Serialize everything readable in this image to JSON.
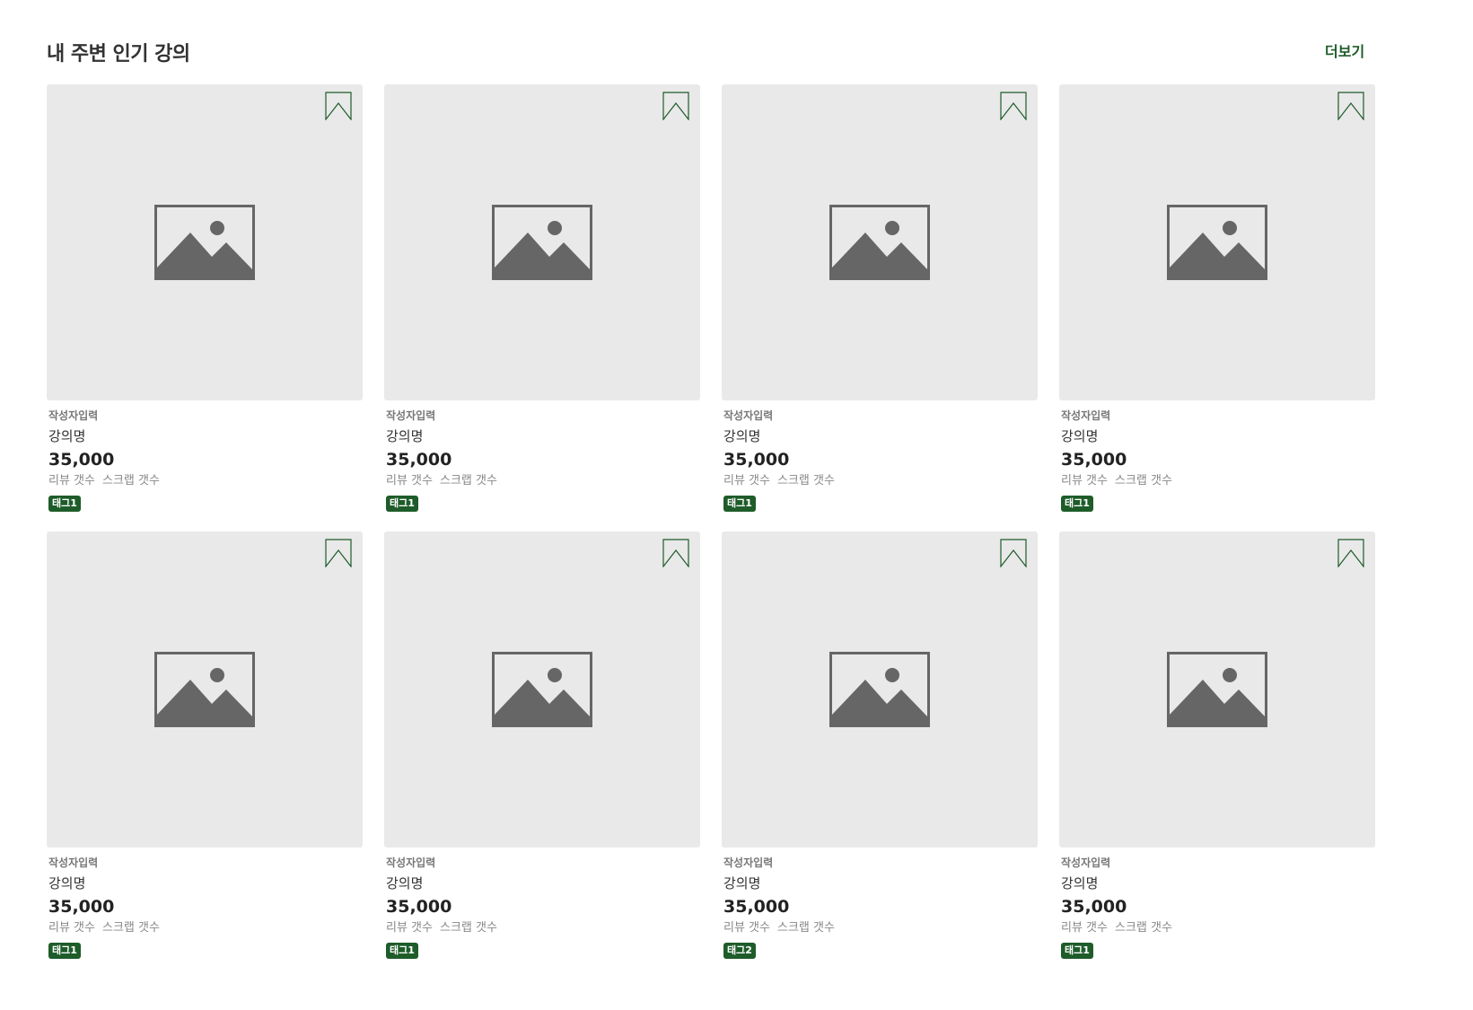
{
  "section": {
    "title": "내 주변 인기 강의",
    "more_label": "더보기"
  },
  "colors": {
    "accent": "#1e5c2a",
    "thumb_bg": "#e9e9e9",
    "placeholder_gray": "#666666"
  },
  "cards": [
    {
      "author": "작성자입력",
      "name": "강의명",
      "price": "35,000",
      "review_label": "리뷰 갯수",
      "scrap_label": "스크랩 갯수",
      "tag": "태그1"
    },
    {
      "author": "작성자입력",
      "name": "강의명",
      "price": "35,000",
      "review_label": "리뷰 갯수",
      "scrap_label": "스크랩 갯수",
      "tag": "태그1"
    },
    {
      "author": "작성자입력",
      "name": "강의명",
      "price": "35,000",
      "review_label": "리뷰 갯수",
      "scrap_label": "스크랩 갯수",
      "tag": "태그1"
    },
    {
      "author": "작성자입력",
      "name": "강의명",
      "price": "35,000",
      "review_label": "리뷰 갯수",
      "scrap_label": "스크랩 갯수",
      "tag": "태그1"
    },
    {
      "author": "작성자입력",
      "name": "강의명",
      "price": "35,000",
      "review_label": "리뷰 갯수",
      "scrap_label": "스크랩 갯수",
      "tag": "태그1"
    },
    {
      "author": "작성자입력",
      "name": "강의명",
      "price": "35,000",
      "review_label": "리뷰 갯수",
      "scrap_label": "스크랩 갯수",
      "tag": "태그1"
    },
    {
      "author": "작성자입력",
      "name": "강의명",
      "price": "35,000",
      "review_label": "리뷰 갯수",
      "scrap_label": "스크랩 갯수",
      "tag": "태그2"
    },
    {
      "author": "작성자입력",
      "name": "강의명",
      "price": "35,000",
      "review_label": "리뷰 갯수",
      "scrap_label": "스크랩 갯수",
      "tag": "태그1"
    }
  ],
  "icons": {
    "bookmark": "bookmark-icon",
    "placeholder": "image-placeholder-icon"
  }
}
